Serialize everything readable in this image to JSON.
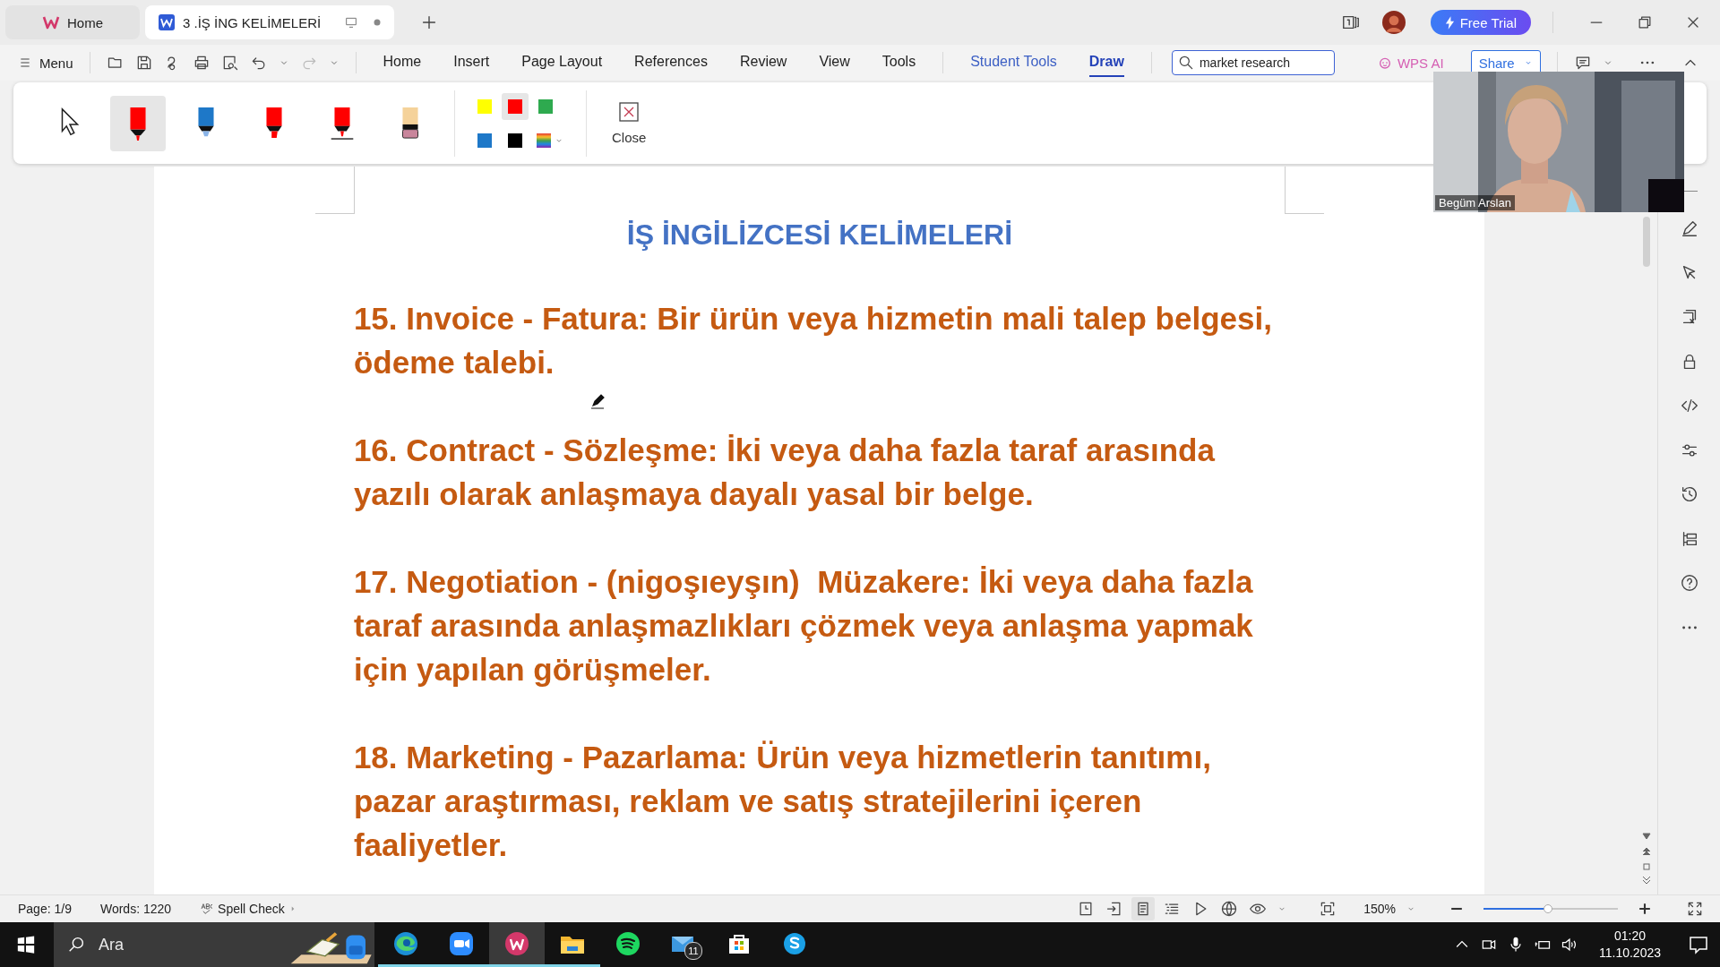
{
  "tabs": [
    {
      "label": "Home",
      "kind": "home",
      "selected": false
    },
    {
      "label": "3 .İŞ İNG KELİMELERİ",
      "kind": "doc",
      "selected": true
    }
  ],
  "menu_label": "Menu",
  "ribbon_tabs": [
    {
      "label": "Home",
      "kind": "plain",
      "selected": false
    },
    {
      "label": "Insert",
      "kind": "plain",
      "selected": false
    },
    {
      "label": "Page Layout",
      "kind": "plain",
      "selected": false
    },
    {
      "label": "References",
      "kind": "plain",
      "selected": false
    },
    {
      "label": "Review",
      "kind": "plain",
      "selected": false
    },
    {
      "label": "View",
      "kind": "plain",
      "selected": false
    },
    {
      "label": "Tools",
      "kind": "plain",
      "selected": false
    },
    {
      "label": "Student Tools",
      "kind": "accent",
      "selected": false
    },
    {
      "label": "Draw",
      "kind": "plain",
      "selected": true
    }
  ],
  "search": {
    "value": "market research"
  },
  "wps_ai": "WPS AI",
  "share": "Share",
  "free_trial": "Free Trial",
  "draw_tools": [
    {
      "kind": "pointer",
      "selected": false
    },
    {
      "kind": "marker",
      "color": "#ff0000",
      "selected": true
    },
    {
      "kind": "pen",
      "color": "#1e78c8",
      "selected": false
    },
    {
      "kind": "highlighter",
      "color": "#ff0000",
      "selected": false
    },
    {
      "kind": "brush",
      "color": "#ff0000",
      "selected": false
    },
    {
      "kind": "eraser",
      "color": "#f5d29a",
      "selected": false
    }
  ],
  "swatches": [
    {
      "color": "#ffff00",
      "selected": false
    },
    {
      "color": "#ff0000",
      "selected": true
    },
    {
      "color": "#2eaa4f",
      "selected": false
    },
    {
      "color": "#1e78c8",
      "selected": false
    },
    {
      "color": "#000000",
      "selected": false
    }
  ],
  "close_label": "Close",
  "document": {
    "title": "İŞ İNGİLİZCESİ KELİMELERİ",
    "paragraphs": [
      "15. Invoice - Fatura: Bir ürün veya hizmetin mali talep belgesi, ödeme talebi.",
      "16. Contract - Sözleşme: İki veya daha fazla taraf arasında yazılı olarak anlaşmaya dayalı yasal bir belge.",
      "17. Negotiation - (nigoşıeyşın)  Müzakere: İki veya daha fazla taraf arasında anlaşmazlıkları çözmek veya anlaşma yapmak için yapılan görüşmeler.",
      "18. Marketing - Pazarlama: Ürün veya hizmetlerin tanıtımı, pazar araştırması, reklam ve satış stratejilerini içeren faaliyetler."
    ]
  },
  "video": {
    "name": "Begüm Arslan"
  },
  "status_bar": {
    "page": "Page: 1/9",
    "words": "Words: 1220",
    "spell_check": "Spell Check",
    "zoom": "150%",
    "zoom_slider": {
      "level": 0.48
    }
  },
  "taskbar": {
    "search_placeholder": "Ara",
    "apps": [
      {
        "kind": "edge",
        "running": true,
        "selected": false
      },
      {
        "kind": "zoom",
        "running": true,
        "selected": false
      },
      {
        "kind": "wps",
        "running": true,
        "selected": true
      },
      {
        "kind": "explorer",
        "running": true,
        "selected": false
      },
      {
        "kind": "spotify",
        "running": false,
        "selected": false
      },
      {
        "kind": "mail",
        "running": false,
        "selected": false,
        "badge": "11"
      },
      {
        "kind": "store",
        "running": false,
        "selected": false
      },
      {
        "kind": "skype",
        "running": false,
        "selected": false
      }
    ],
    "time": "01:20",
    "date": "11.10.2023"
  }
}
